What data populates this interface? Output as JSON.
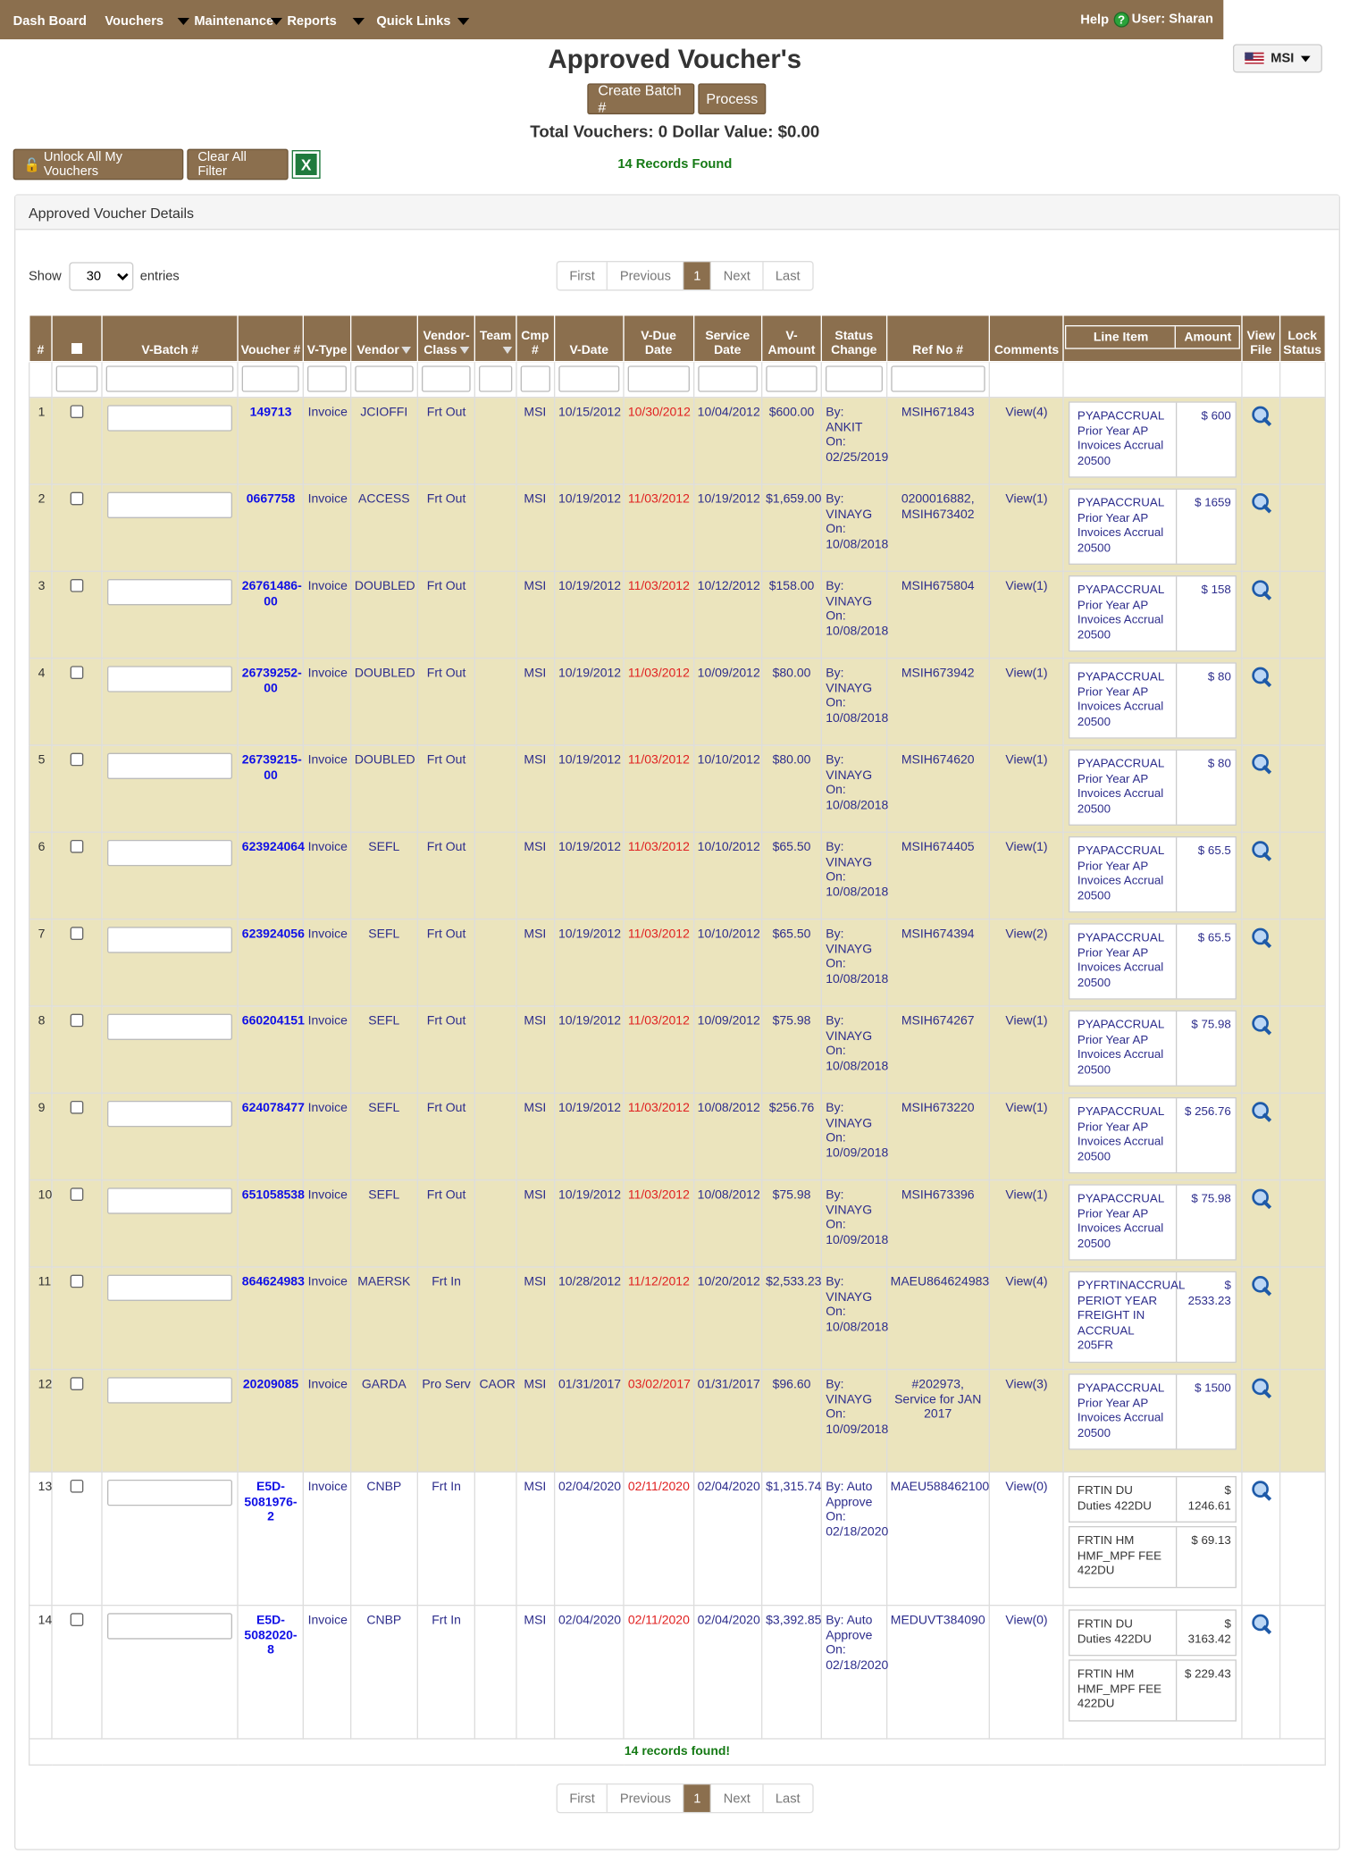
{
  "nav": {
    "dashboard": "Dash Board",
    "vouchers": "Vouchers",
    "maintenance": "Maintenance",
    "reports": "Reports",
    "quick_links": "Quick Links",
    "help": "Help",
    "user": "User:  Sharan"
  },
  "title": "Approved Voucher's",
  "company": "MSI",
  "buttons": {
    "create_batch": "Create Batch #",
    "process": "Process",
    "unlock": "Unlock All My Vouchers",
    "clear": "Clear All Filter"
  },
  "totals": "Total Vouchers: 0 Dollar Value: $0.00",
  "records_found": "14 Records Found",
  "panel_title": "Approved Voucher Details",
  "show": {
    "label": "Show",
    "value": "30",
    "suffix": "entries"
  },
  "pager": {
    "first": "First",
    "prev": "Previous",
    "page": "1",
    "next": "Next",
    "last": "Last"
  },
  "columns": {
    "num": "#",
    "batch": "V-Batch #",
    "voucher": "Voucher #",
    "vtype": "V-Type",
    "vendor": "Vendor",
    "vclass": "Vendor-Class",
    "team": "Team",
    "cmp": "Cmp #",
    "vdate": "V-Date",
    "vdue": "V-Due Date",
    "sdate": "Service Date",
    "vamount": "V-Amount",
    "status": "Status Change",
    "ref": "Ref No #",
    "comments": "Comments",
    "lineitem": "Line Item",
    "amount": "Amount",
    "viewfile": "View File",
    "lock": "Lock Status"
  },
  "rows": [
    {
      "n": "1",
      "voucher": "149713",
      "vtype": "Invoice",
      "vendor": "JCIOFFI",
      "vclass": "Frt Out",
      "team": "",
      "cmp": "MSI",
      "vdate": "10/15/2012",
      "vdue": "10/30/2012",
      "sdate": "10/04/2012",
      "vamount": "$600.00",
      "status": "By: ANKIT On: 02/25/2019",
      "ref": "MSIH671843",
      "comments": "View(4)",
      "items": [
        {
          "desc": "PYAPACCRUAL Prior Year AP Invoices Accrual 20500",
          "amt": "$ 600"
        }
      ]
    },
    {
      "n": "2",
      "voucher": "0667758",
      "vtype": "Invoice",
      "vendor": "ACCESS",
      "vclass": "Frt Out",
      "team": "",
      "cmp": "MSI",
      "vdate": "10/19/2012",
      "vdue": "11/03/2012",
      "sdate": "10/19/2012",
      "vamount": "$1,659.00",
      "status": "By: VINAYG On: 10/08/2018",
      "ref": "0200016882, MSIH673402",
      "comments": "View(1)",
      "items": [
        {
          "desc": "PYAPACCRUAL Prior Year AP Invoices Accrual 20500",
          "amt": "$ 1659"
        }
      ]
    },
    {
      "n": "3",
      "voucher": "26761486-00",
      "vtype": "Invoice",
      "vendor": "DOUBLED",
      "vclass": "Frt Out",
      "team": "",
      "cmp": "MSI",
      "vdate": "10/19/2012",
      "vdue": "11/03/2012",
      "sdate": "10/12/2012",
      "vamount": "$158.00",
      "status": "By: VINAYG On: 10/08/2018",
      "ref": "MSIH675804",
      "comments": "View(1)",
      "items": [
        {
          "desc": "PYAPACCRUAL Prior Year AP Invoices Accrual 20500",
          "amt": "$ 158"
        }
      ]
    },
    {
      "n": "4",
      "voucher": "26739252-00",
      "vtype": "Invoice",
      "vendor": "DOUBLED",
      "vclass": "Frt Out",
      "team": "",
      "cmp": "MSI",
      "vdate": "10/19/2012",
      "vdue": "11/03/2012",
      "sdate": "10/09/2012",
      "vamount": "$80.00",
      "status": "By: VINAYG On: 10/08/2018",
      "ref": "MSIH673942",
      "comments": "View(1)",
      "items": [
        {
          "desc": "PYAPACCRUAL Prior Year AP Invoices Accrual 20500",
          "amt": "$ 80"
        }
      ]
    },
    {
      "n": "5",
      "voucher": "26739215-00",
      "vtype": "Invoice",
      "vendor": "DOUBLED",
      "vclass": "Frt Out",
      "team": "",
      "cmp": "MSI",
      "vdate": "10/19/2012",
      "vdue": "11/03/2012",
      "sdate": "10/10/2012",
      "vamount": "$80.00",
      "status": "By: VINAYG On: 10/08/2018",
      "ref": "MSIH674620",
      "comments": "View(1)",
      "items": [
        {
          "desc": "PYAPACCRUAL Prior Year AP Invoices Accrual 20500",
          "amt": "$ 80"
        }
      ]
    },
    {
      "n": "6",
      "voucher": "623924064",
      "vtype": "Invoice",
      "vendor": "SEFL",
      "vclass": "Frt Out",
      "team": "",
      "cmp": "MSI",
      "vdate": "10/19/2012",
      "vdue": "11/03/2012",
      "sdate": "10/10/2012",
      "vamount": "$65.50",
      "status": "By: VINAYG On: 10/08/2018",
      "ref": "MSIH674405",
      "comments": "View(1)",
      "items": [
        {
          "desc": "PYAPACCRUAL Prior Year AP Invoices Accrual 20500",
          "amt": "$ 65.5"
        }
      ]
    },
    {
      "n": "7",
      "voucher": "623924056",
      "vtype": "Invoice",
      "vendor": "SEFL",
      "vclass": "Frt Out",
      "team": "",
      "cmp": "MSI",
      "vdate": "10/19/2012",
      "vdue": "11/03/2012",
      "sdate": "10/10/2012",
      "vamount": "$65.50",
      "status": "By: VINAYG On: 10/08/2018",
      "ref": "MSIH674394",
      "comments": "View(2)",
      "items": [
        {
          "desc": "PYAPACCRUAL Prior Year AP Invoices Accrual 20500",
          "amt": "$ 65.5"
        }
      ]
    },
    {
      "n": "8",
      "voucher": "660204151",
      "vtype": "Invoice",
      "vendor": "SEFL",
      "vclass": "Frt Out",
      "team": "",
      "cmp": "MSI",
      "vdate": "10/19/2012",
      "vdue": "11/03/2012",
      "sdate": "10/09/2012",
      "vamount": "$75.98",
      "status": "By: VINAYG On: 10/08/2018",
      "ref": "MSIH674267",
      "comments": "View(1)",
      "items": [
        {
          "desc": "PYAPACCRUAL Prior Year AP Invoices Accrual 20500",
          "amt": "$ 75.98"
        }
      ]
    },
    {
      "n": "9",
      "voucher": "624078477",
      "vtype": "Invoice",
      "vendor": "SEFL",
      "vclass": "Frt Out",
      "team": "",
      "cmp": "MSI",
      "vdate": "10/19/2012",
      "vdue": "11/03/2012",
      "sdate": "10/08/2012",
      "vamount": "$256.76",
      "status": "By: VINAYG On: 10/09/2018",
      "ref": "MSIH673220",
      "comments": "View(1)",
      "items": [
        {
          "desc": "PYAPACCRUAL Prior Year AP Invoices Accrual 20500",
          "amt": "$ 256.76"
        }
      ]
    },
    {
      "n": "10",
      "voucher": "651058538",
      "vtype": "Invoice",
      "vendor": "SEFL",
      "vclass": "Frt Out",
      "team": "",
      "cmp": "MSI",
      "vdate": "10/19/2012",
      "vdue": "11/03/2012",
      "sdate": "10/08/2012",
      "vamount": "$75.98",
      "status": "By: VINAYG On: 10/09/2018",
      "ref": "MSIH673396",
      "comments": "View(1)",
      "items": [
        {
          "desc": "PYAPACCRUAL Prior Year AP Invoices Accrual 20500",
          "amt": "$ 75.98"
        }
      ]
    },
    {
      "n": "11",
      "voucher": "864624983",
      "vtype": "Invoice",
      "vendor": "MAERSK",
      "vclass": "Frt In",
      "team": "",
      "cmp": "MSI",
      "vdate": "10/28/2012",
      "vdue": "11/12/2012",
      "sdate": "10/20/2012",
      "vamount": "$2,533.23",
      "status": "By: VINAYG On: 10/08/2018",
      "ref": "MAEU864624983",
      "comments": "View(4)",
      "items": [
        {
          "desc": "PYFRTINACCRUAL PERIOT YEAR FREIGHT IN ACCRUAL 205FR",
          "amt": "$ 2533.23"
        }
      ]
    },
    {
      "n": "12",
      "voucher": "20209085",
      "vtype": "Invoice",
      "vendor": "GARDA",
      "vclass": "Pro Serv",
      "team": "CAOR",
      "cmp": "MSI",
      "vdate": "01/31/2017",
      "vdue": "03/02/2017",
      "sdate": "01/31/2017",
      "vamount": "$96.60",
      "status": "By: VINAYG On: 10/09/2018",
      "ref": "#202973, Service for JAN 2017",
      "comments": "View(3)",
      "items": [
        {
          "desc": "PYAPACCRUAL Prior Year AP Invoices Accrual 20500",
          "amt": "$ 1500"
        }
      ]
    },
    {
      "n": "13",
      "voucher": "E5D-5081976-2",
      "vtype": "Invoice",
      "vendor": "CNBP",
      "vclass": "Frt In",
      "team": "",
      "cmp": "MSI",
      "vdate": "02/04/2020",
      "vdue": "02/11/2020",
      "sdate": "02/04/2020",
      "vamount": "$1,315.74",
      "status": "By: Auto Approve On: 02/18/2020",
      "ref": "MAEU588462100",
      "comments": "View(0)",
      "items": [
        {
          "desc": "FRTIN DU Duties 422DU",
          "amt": "$ 1246.61"
        },
        {
          "desc": "FRTIN HM HMF_MPF FEE 422DU",
          "amt": "$ 69.13"
        }
      ]
    },
    {
      "n": "14",
      "voucher": "E5D-5082020-8",
      "vtype": "Invoice",
      "vendor": "CNBP",
      "vclass": "Frt In",
      "team": "",
      "cmp": "MSI",
      "vdate": "02/04/2020",
      "vdue": "02/11/2020",
      "sdate": "02/04/2020",
      "vamount": "$3,392.85",
      "status": "By: Auto Approve On: 02/18/2020",
      "ref": "MEDUVT384090",
      "comments": "View(0)",
      "items": [
        {
          "desc": "FRTIN DU Duties 422DU",
          "amt": "$ 3163.42"
        },
        {
          "desc": "FRTIN HM HMF_MPF FEE 422DU",
          "amt": "$ 229.43"
        }
      ]
    }
  ],
  "footer": "14 records found!"
}
